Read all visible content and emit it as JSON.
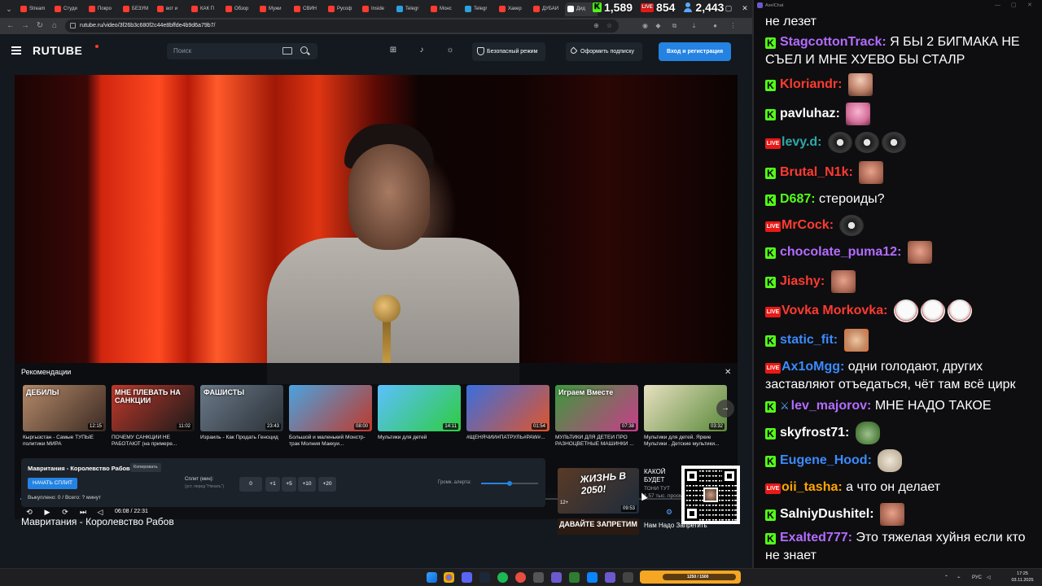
{
  "browser": {
    "tabs": [
      {
        "label": "Stream",
        "color": "#ff3b30"
      },
      {
        "label": "Студи",
        "color": "#ff3b30"
      },
      {
        "label": "Покро",
        "color": "#ff3b30"
      },
      {
        "label": "БЕЗУМ",
        "color": "#ff3b30"
      },
      {
        "label": "вот и",
        "color": "#ff3b30"
      },
      {
        "label": "КАК П",
        "color": "#ff3b30"
      },
      {
        "label": "Обзор",
        "color": "#ff3b30"
      },
      {
        "label": "Мужи",
        "color": "#ff3b30"
      },
      {
        "label": "СВИН",
        "color": "#ff3b30"
      },
      {
        "label": "Русоф",
        "color": "#ff3b30"
      },
      {
        "label": "Inside",
        "color": "#ff3b30"
      },
      {
        "label": "Telegr",
        "color": "#2aa1de"
      },
      {
        "label": "Монс",
        "color": "#ff3b30"
      },
      {
        "label": "Telegr",
        "color": "#2aa1de"
      },
      {
        "label": "Хакер",
        "color": "#ff3b30"
      },
      {
        "label": "ДУБАИ",
        "color": "#ff3b30"
      },
      {
        "label": "Дид",
        "color": "#ffffff"
      }
    ],
    "url": "rutube.ru/video/3f26b3c680f2c44e8bffde4b9d6a79b7/"
  },
  "stream_stats": {
    "kick_viewers": "1,589",
    "live_viewers": "854",
    "total_viewers": "2,443"
  },
  "rutube": {
    "logo": "RUTUBE",
    "search_placeholder": "Поиск",
    "safe_mode_label": "Безопасный режим",
    "subscribe_label": "Оформить подписку",
    "login_label": "Вход и регистрация",
    "accent": "#2483e2"
  },
  "player": {
    "recs_title": "Рекомендации",
    "recommendations": [
      {
        "thumb_text": "ДЕБИЛЫ",
        "duration": "12:15",
        "title": "Кыргызстан - Самые ТУПЫЕ политики МИРА",
        "bg": "linear-gradient(135deg,#b58a6a,#3b2a22)"
      },
      {
        "thumb_text": "МНЕ ПЛЕВАТЬ НА САНКЦИИ",
        "duration": "11:02",
        "title": "ПОЧЕМУ САНКЦИИ НЕ РАБОТАЮТ (на примере...",
        "bg": "linear-gradient(135deg,#c0392b,#1a1a1a)"
      },
      {
        "thumb_text": "ФАШИСТЫ",
        "duration": "23:43",
        "title": "Израиль - Как Продать Геноцид",
        "bg": "linear-gradient(135deg,#6a7a8a,#2a2f35)"
      },
      {
        "thumb_text": "",
        "duration": "08:00",
        "title": "Большой и маленький Монстр-трак Молния Маккуи...",
        "bg": "linear-gradient(135deg,#4aa3e0,#c0392b)"
      },
      {
        "thumb_text": "",
        "duration": "14:11",
        "title": "Мультики для детей",
        "bg": "linear-gradient(135deg,#5bc0ff,#2ecc40)"
      },
      {
        "thumb_text": "",
        "duration": "01:54",
        "title": "#ЩЕНЯЧИЙ#ПАТРУЛЬ#PAW#...",
        "bg": "linear-gradient(135deg,#3a6ee0,#e0552a)"
      },
      {
        "thumb_text": "Играем Вместе",
        "duration": "07:38",
        "title": "МУЛЬТИКИ ДЛЯ ДЕТЕЙ ПРО РАЗНОЦВЕТНЫЕ МАШИНКИ ...",
        "bg": "linear-gradient(135deg,#3c9a3c,#c93c8a)"
      },
      {
        "thumb_text": "",
        "duration": "03:32",
        "title": "Мультики для детей. Яркие Мультики . Детские мультики...",
        "bg": "linear-gradient(135deg,#e8e0c0,#5a8a3a)"
      }
    ],
    "progress": 0.273,
    "buffered": 0.4,
    "time_label": "06:08 / 22:31"
  },
  "info_panel": {
    "title": "Мавритания - Королевство Рабов",
    "copy_label": "Копировать",
    "start_split_label": "НАЧАТЬ СПЛИТ",
    "stats": "Выкуплено: 0 / Всего: ? минут",
    "split_label": "Сплит (мин):",
    "split_hint": "(уст. перед \"Начать\")",
    "split_buttons": [
      "0",
      "+1",
      "+5",
      "+10",
      "+20"
    ],
    "volume_label": "Громк. алерта:",
    "volume": 0.5
  },
  "video_title": "Мавритания - Королевство Рабов",
  "side_card": {
    "thumb_text": "ЖИЗНЬ В 2050!",
    "age": "12+",
    "duration": "09:53",
    "title": "КАКОЙ БУДЕТ ЖИЗНЬ В 2050",
    "channel": "ТОНИ ТУТ",
    "views": "1,57 тыс. просм.",
    "thumb2_text": "ДАВАЙТЕ ЗАПРЕТИМ",
    "title2": "Нам Надо Запретить"
  },
  "chat": {
    "app_title": "AxelChat",
    "messages": [
      {
        "platform": "",
        "user": "",
        "color": "#ffffff",
        "text": "не лезет",
        "emotes": []
      },
      {
        "platform": "kick",
        "user": "StagcottonTrack",
        "color": "#b36cff",
        "text": "Я БЫ 2 БИГМАКА НЕ СЪЕЛ И МНЕ ХУЕВО БЫ СТАЛР",
        "emotes": []
      },
      {
        "platform": "kick",
        "user": "Kloriandr",
        "color": "#ff3b30",
        "text": "",
        "emotes": [
          "em-bald"
        ]
      },
      {
        "platform": "kick",
        "user": "pavluhaz",
        "color": "#ffffff",
        "text": "",
        "emotes": [
          "em-pepe"
        ]
      },
      {
        "platform": "live",
        "user": "levy.d",
        "color": "#2ea8a8",
        "text": "",
        "emotes": [
          "em-cat",
          "em-cat",
          "em-cat"
        ]
      },
      {
        "platform": "kick",
        "user": "Brutal_N1k",
        "color": "#ff3b30",
        "text": "",
        "emotes": [
          "em-face"
        ]
      },
      {
        "platform": "kick",
        "user": "D687",
        "color": "#53fc18",
        "text": "стероиды?",
        "emotes": []
      },
      {
        "platform": "live",
        "user": "MrCock",
        "color": "#ff3b30",
        "text": "",
        "emotes": [
          "em-cat"
        ]
      },
      {
        "platform": "kick",
        "user": "chocolate_puma12",
        "color": "#b36cff",
        "text": "",
        "emotes": [
          "em-face"
        ]
      },
      {
        "platform": "kick",
        "user": "Jiashy",
        "color": "#ff3b30",
        "text": "",
        "emotes": [
          "em-face"
        ]
      },
      {
        "platform": "live",
        "user": "Vovka Morkovka",
        "color": "#ff3b30",
        "text": "",
        "emotes": [
          "em-mask",
          "em-mask",
          "em-mask"
        ]
      },
      {
        "platform": "kick",
        "user": "static_fit",
        "color": "#3b8bff",
        "text": "",
        "emotes": [
          "em-hot"
        ]
      },
      {
        "platform": "live",
        "user": "Ax1oMgg",
        "color": "#3b8bff",
        "text": "одни голодают, других заставляют отъедаться, чёт там всё цирк",
        "emotes": []
      },
      {
        "platform": "kick",
        "user": "lev_majorov",
        "color": "#b36cff",
        "text": "МНЕ НАДО ТАКОЕ",
        "emotes": [],
        "badge": "sword"
      },
      {
        "platform": "kick",
        "user": "skyfrost71",
        "color": "#ffffff",
        "text": "",
        "emotes": [
          "em-frog"
        ]
      },
      {
        "platform": "kick",
        "user": "Eugene_Hood",
        "color": "#3b8bff",
        "text": "",
        "emotes": [
          "em-dog"
        ]
      },
      {
        "platform": "live",
        "user": "oii_tasha",
        "color": "#ffa500",
        "text": "а что он делает",
        "emotes": []
      },
      {
        "platform": "kick",
        "user": "SalniyDushitel",
        "color": "#ffffff",
        "text": "",
        "emotes": [
          "em-face"
        ]
      },
      {
        "platform": "kick",
        "user": "Exalted777",
        "color": "#b36cff",
        "text": "Это тяжелая хуйня если кто не знает",
        "emotes": []
      }
    ]
  },
  "taskbar": {
    "media_text": "1250 / 1500",
    "lang": "РУС",
    "time": "17:25",
    "date": "03.11.2025"
  }
}
